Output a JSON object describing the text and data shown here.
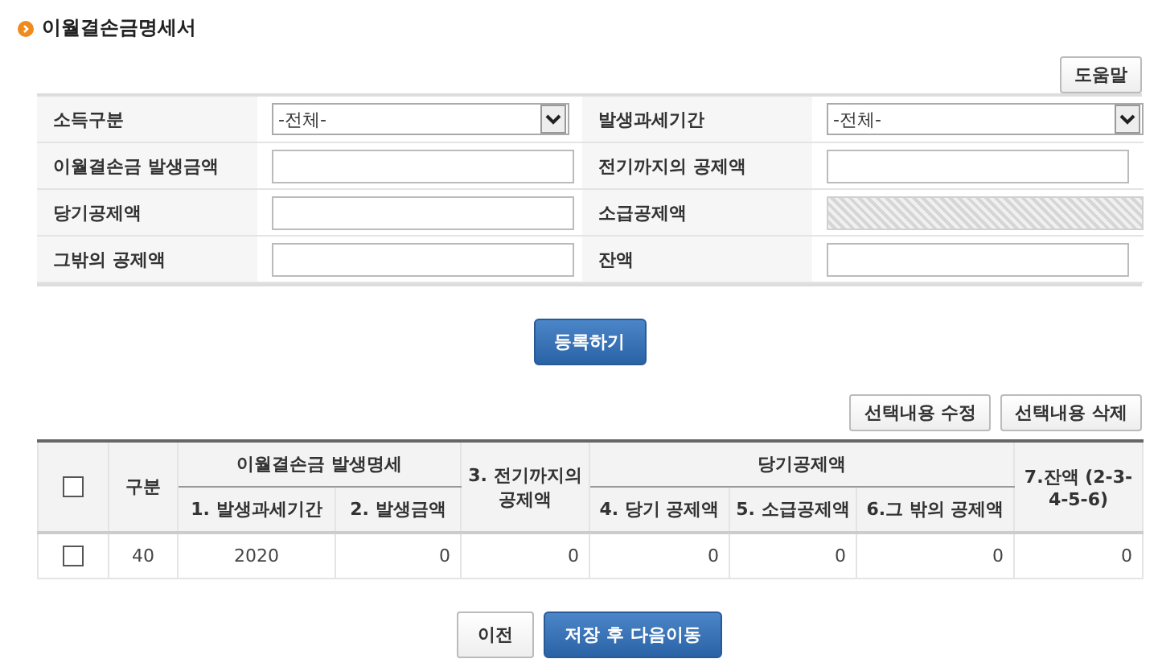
{
  "title": "이월결손금명세서",
  "help_button": "도움말",
  "form": {
    "fields": [
      {
        "label": "소득구분",
        "kind": "select",
        "value": "-전체-"
      },
      {
        "label": "발생과세기간",
        "kind": "select",
        "value": "-전체-"
      },
      {
        "label": "이월결손금 발생금액",
        "kind": "input",
        "disabled": false
      },
      {
        "label": "전기까지의 공제액",
        "kind": "input",
        "disabled": false
      },
      {
        "label": "당기공제액",
        "kind": "input",
        "disabled": false
      },
      {
        "label": "소급공제액",
        "kind": "input",
        "disabled": true
      },
      {
        "label": "그밖의 공제액",
        "kind": "input",
        "disabled": false
      },
      {
        "label": "잔액",
        "kind": "input",
        "disabled": false
      }
    ]
  },
  "register_button": "등록하기",
  "table_buttons": [
    "선택내용 수정",
    "선택내용 삭제"
  ],
  "table_group_headers": [
    "이월결손금 발생명세",
    "당기공제액"
  ],
  "table": {
    "columns": [
      {
        "kind": "checkbox",
        "checked": false
      },
      {
        "kind": "text",
        "label": "구분"
      },
      {
        "kind": "text",
        "label": "1. 발생과세기간"
      },
      {
        "kind": "text",
        "label": "2. 발생금액"
      },
      {
        "kind": "text",
        "label": "3. 전기까지의 공제액"
      },
      {
        "kind": "text",
        "label": "4. 당기 공제액"
      },
      {
        "kind": "text",
        "label": "5. 소급공제액"
      },
      {
        "kind": "text",
        "label": "6.그 밖의 공제액"
      },
      {
        "kind": "text",
        "label": "7.잔액 (2-3-4-5-6)"
      }
    ],
    "rows": [
      {
        "cells": [
          {
            "kind": "checkbox",
            "checked": false
          },
          {
            "kind": "text",
            "text": "40"
          },
          {
            "kind": "text",
            "text": "2020"
          },
          {
            "kind": "text",
            "text": "0"
          },
          {
            "kind": "text",
            "text": "0"
          },
          {
            "kind": "text",
            "text": "0"
          },
          {
            "kind": "text",
            "text": "0"
          },
          {
            "kind": "text",
            "text": "0"
          },
          {
            "kind": "text",
            "text": "0"
          }
        ]
      }
    ]
  },
  "bottom_buttons": [
    {
      "label": "이전",
      "kind": "secondary"
    },
    {
      "label": "저장 후 다음이동",
      "kind": "primary"
    }
  ]
}
